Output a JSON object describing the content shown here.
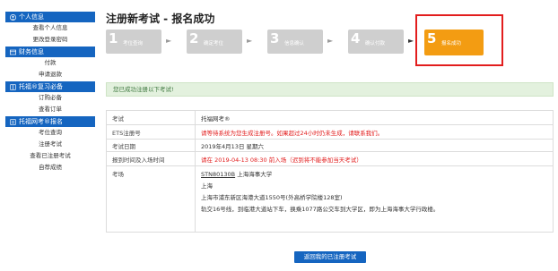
{
  "sidebar": {
    "sections": [
      {
        "title": "个人信息",
        "items": [
          "查看个人信息",
          "更改登录密码"
        ]
      },
      {
        "title": "财务信息",
        "items": [
          "付款",
          "申请退款"
        ]
      },
      {
        "title": "托福®复习必备",
        "items": [
          "订购必备",
          "查看订单"
        ]
      },
      {
        "title": "托福网考®报名",
        "items": [
          "考位查询",
          "注册考试",
          "查看已注册考试",
          "自荐成绩"
        ]
      }
    ]
  },
  "page": {
    "title": "注册新考试 - 报名成功"
  },
  "steps": [
    {
      "num": "1",
      "label": "考位查询"
    },
    {
      "num": "2",
      "label": "确定考位"
    },
    {
      "num": "3",
      "label": "信息确认"
    },
    {
      "num": "4",
      "label": "确认付款"
    },
    {
      "num": "5",
      "label": "报名成功"
    }
  ],
  "notice": "您已成功注册以下考试!",
  "table": {
    "rows": [
      {
        "label": "考试",
        "value": "托福网考®"
      },
      {
        "label": "ETS注册号",
        "value": "请等待系统为您生成注册号。如果超过24小时仍未生成，请联系我们。"
      },
      {
        "label": "考试日期",
        "value": "2019年4月13日 星期六"
      },
      {
        "label": "报到时间及入场时间",
        "value": "请在 2019-04-13 08:30 前入场（迟到将不能参加当天考试）"
      },
      {
        "label": "考场",
        "code": "STN80130B",
        "name": "上海海事大学",
        "lines": [
          "上海",
          "上海市浦东新区海港大道1550号(外高桥学院楼128室)",
          "轨交16号线，到临港大道站下车，换乘1077路公交车到大学区，即为上海海事大学行政楼。"
        ]
      }
    ]
  },
  "button": {
    "label": "返回我的已注册考试"
  },
  "colors": {
    "primary": "#1565c0",
    "active_step": "#f39c12",
    "highlight": "#e21d1d"
  }
}
